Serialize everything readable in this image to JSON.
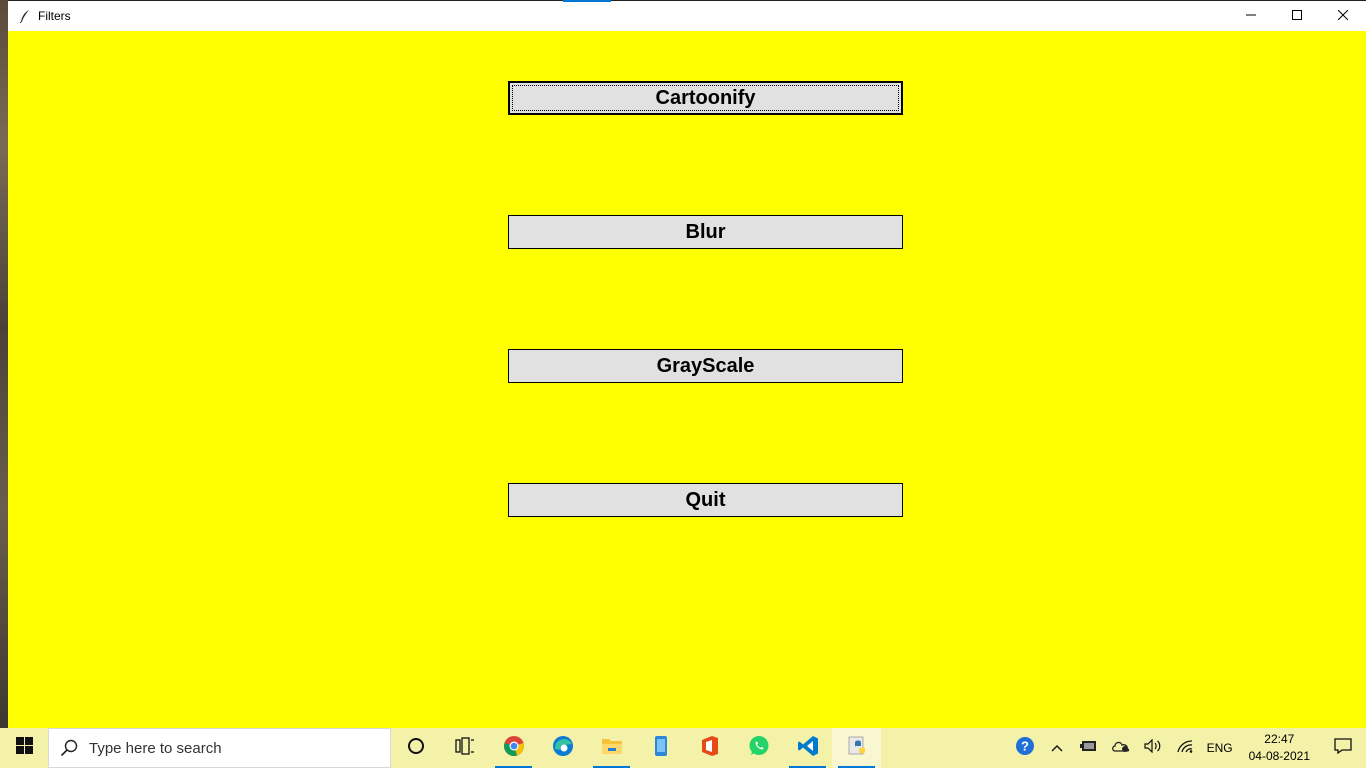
{
  "window": {
    "title": "Filters",
    "background": "#ffff00",
    "controls": [
      "minimize-icon",
      "maximize-icon",
      "close-icon"
    ]
  },
  "buttons": [
    {
      "label": "Cartoonify",
      "focused": true
    },
    {
      "label": "Blur",
      "focused": false
    },
    {
      "label": "GrayScale",
      "focused": false
    },
    {
      "label": "Quit",
      "focused": false
    }
  ],
  "taskbar": {
    "search_placeholder": "Type here to search",
    "pinned": [
      "cortana-icon",
      "task-view-icon",
      "chrome-icon",
      "edge-icon",
      "file-explorer-icon",
      "phone-icon",
      "office-icon",
      "whatsapp-icon",
      "vscode-icon",
      "python-icon"
    ],
    "tray": {
      "language": "ENG",
      "time": "22:47",
      "date": "04-08-2021"
    }
  }
}
